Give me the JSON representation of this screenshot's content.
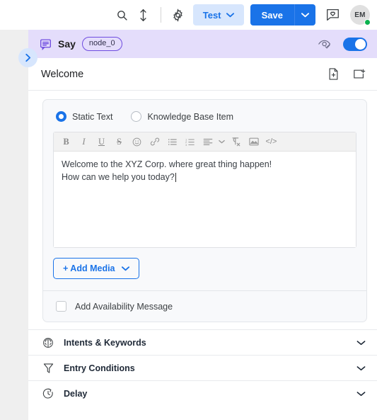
{
  "topbar": {
    "search_icon": "search-icon",
    "resize_icon": "vertical-resize-icon",
    "settings_icon": "gear-icon",
    "test_label": "Test",
    "save_label": "Save",
    "feedback_icon": "feedback-icon",
    "avatar_initials": "EM",
    "accent_color": "#1a73e8",
    "test_bg_color": "#d7e6fd",
    "status_color": "#0ab14e"
  },
  "node_header": {
    "icon": "say-message-icon",
    "label": "Say",
    "chip": "node_0",
    "preview_icon": "eye-check-icon",
    "toggle_on": true,
    "bg_color": "#e4ddfb",
    "accent_color": "#6f4ce0"
  },
  "expand_handle": {
    "icon": "chevron-right-icon"
  },
  "panel": {
    "title": "Welcome",
    "title_icons": [
      {
        "name": "add-document-icon"
      },
      {
        "name": "add-panel-icon"
      }
    ]
  },
  "content_type": {
    "options": [
      {
        "label": "Static Text",
        "selected": true
      },
      {
        "label": "Knowledge Base Item",
        "selected": false
      }
    ]
  },
  "editor": {
    "toolbar": [
      {
        "name": "bold-icon",
        "glyph": "B"
      },
      {
        "name": "italic-icon",
        "glyph": "I"
      },
      {
        "name": "underline-icon",
        "glyph": "U"
      },
      {
        "name": "strikethrough-icon",
        "glyph": "S"
      },
      {
        "name": "emoji-icon",
        "glyph": "☺"
      },
      {
        "name": "link-icon",
        "glyph": "%"
      },
      {
        "name": "bullet-list-icon",
        "glyph": "≡"
      },
      {
        "name": "numbered-list-icon",
        "glyph": "≡"
      },
      {
        "name": "align-icon",
        "glyph": "≡"
      },
      {
        "name": "clear-format-icon",
        "glyph": "¶"
      },
      {
        "name": "image-icon",
        "glyph": "▣"
      },
      {
        "name": "code-icon",
        "glyph": "</>"
      }
    ],
    "lines": [
      "Welcome to the XYZ Corp. where great thing happen!",
      "How can we help you today?"
    ]
  },
  "add_media": {
    "label": "+ Add Media",
    "caret_icon": "chevron-down-icon"
  },
  "availability": {
    "label": "Add Availability Message",
    "checked": false
  },
  "sections": [
    {
      "icon": "brain-icon",
      "label": "Intents & Keywords",
      "caret": "chevron-down-icon"
    },
    {
      "icon": "funnel-icon",
      "label": "Entry Conditions",
      "caret": "chevron-down-icon"
    },
    {
      "icon": "clock-delay-icon",
      "label": "Delay",
      "caret": "chevron-down-icon"
    }
  ]
}
